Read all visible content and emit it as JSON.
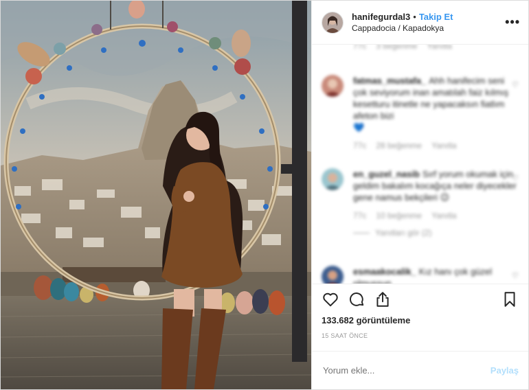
{
  "header": {
    "username": "hanifegurdal3",
    "separator": "•",
    "follow_label": "Takip Et",
    "location": "Cappadocia / Kapadokya",
    "more_icon": "more-horizontal-icon"
  },
  "comments": [
    {
      "meta_time": "77c",
      "meta_likes": "3 beğenme",
      "meta_reply": "Yanıtla"
    },
    {
      "username": "fatmas_mustafa_",
      "text": "Ahh hanifecim seni çok seviyorum inan amatılah faiz kılmış kesetturu itinetle ne yapacaksın fiatlım afeton bizi",
      "emoji": "💙",
      "meta_time": "77c",
      "meta_likes": "28 beğenme",
      "meta_reply": "Yanıtla"
    },
    {
      "username": "en_guzel_nasib",
      "text": "Sırf yorum okumak için geldim bakalım kocağıça neler diyecekler gene namus bekçileri",
      "emoji": "😉",
      "meta_time": "77c",
      "meta_likes": "10 beğenme",
      "meta_reply": "Yanıtla",
      "replies": "Yanıtları gör (2)"
    },
    {
      "username": "esmaakocalik_",
      "text": "Kız hanı çok güzel olmuşsun"
    }
  ],
  "actions": {
    "views": "133.682 görüntüleme",
    "time": "15 SAAT ÖNCE"
  },
  "add_comment": {
    "placeholder": "Yorum ekle...",
    "post_label": "Paylaş"
  },
  "colors": {
    "follow": "#3897f0",
    "post_disabled": "#b2dffc",
    "secondary_text": "#999999",
    "border": "#dbdbdb"
  }
}
